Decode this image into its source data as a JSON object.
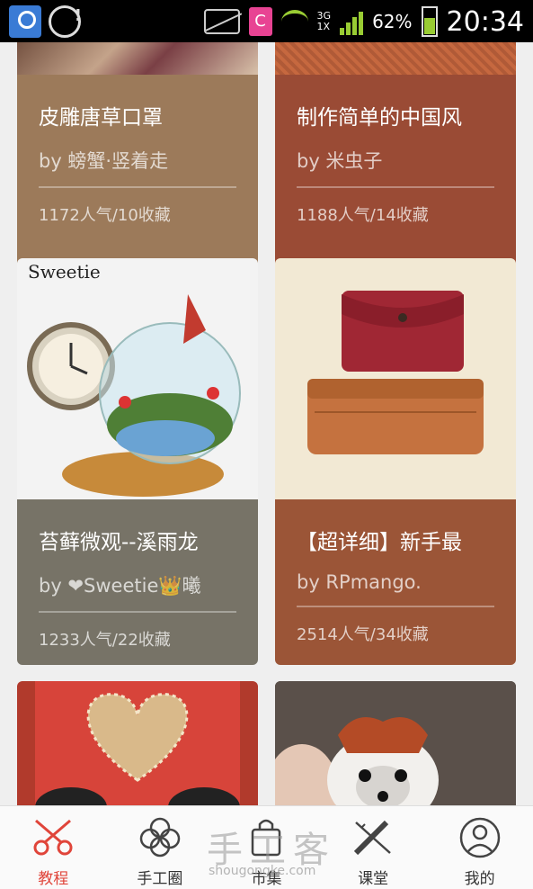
{
  "status_bar": {
    "network": "3G",
    "sim": "1X",
    "battery": "62%",
    "time": "20:34",
    "icons": [
      "app-icon",
      "disc-alert-icon",
      "mute-icon",
      "c-app-icon",
      "wifi-icon",
      "signal-icon",
      "battery-icon"
    ]
  },
  "cards": [
    {
      "title": "皮雕唐草口罩",
      "author": "by 螃蟹·竖着走",
      "stats": "1172人气/10收藏",
      "color": "#9c7a5a"
    },
    {
      "title": "制作简单的中国风",
      "author": "by 米虫子",
      "stats": "1188人气/14收藏",
      "color": "#9a4b35"
    },
    {
      "title": "苔藓微观--溪雨龙",
      "author": "by ❤Sweetie👑曦",
      "stats": "1233人气/22收藏",
      "color": "#777367"
    },
    {
      "title": "【超详细】新手最",
      "author": "by RPmango.",
      "stats": "2514人气/34收藏",
      "color": "#9b5537"
    },
    {
      "title": "",
      "author": "",
      "stats": "",
      "color": "#b13a2c"
    },
    {
      "title": "",
      "author": "",
      "stats": "",
      "color": "#4a3f3a"
    }
  ],
  "image_texts": {
    "sweetie_logo": "Sweetie"
  },
  "watermark": {
    "main": "手工客",
    "sub": "shougongke.com"
  },
  "bottom_nav": [
    {
      "label": "教程",
      "icon": "scissors-icon",
      "active": true
    },
    {
      "label": "手工圈",
      "icon": "flower-icon",
      "active": false
    },
    {
      "label": "市集",
      "icon": "bag-icon",
      "active": false
    },
    {
      "label": "课堂",
      "icon": "pencil-ruler-icon",
      "active": false
    },
    {
      "label": "我的",
      "icon": "person-icon",
      "active": false
    }
  ]
}
